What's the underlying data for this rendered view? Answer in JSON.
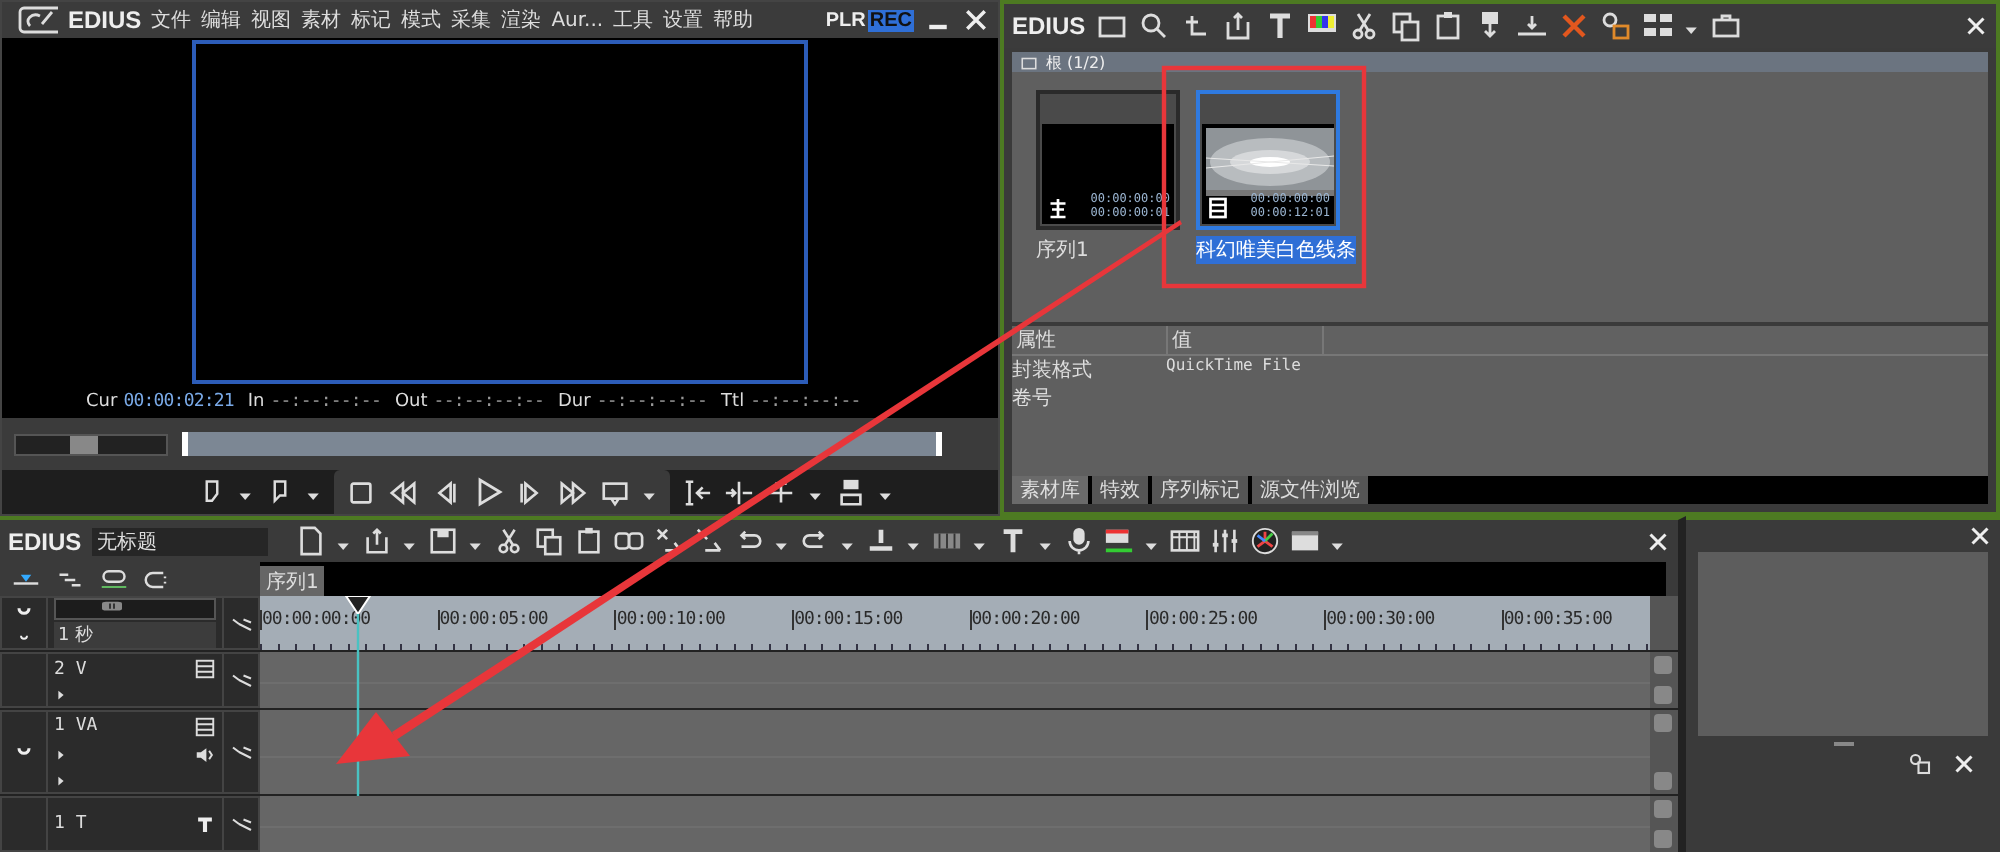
{
  "player": {
    "app_name": "EDIUS",
    "menu": [
      "文件",
      "编辑",
      "视图",
      "素材",
      "标记",
      "模式",
      "采集",
      "渲染",
      "Aur...",
      "工具",
      "设置",
      "帮助"
    ],
    "modes": [
      {
        "label": "PLR",
        "selected": false
      },
      {
        "label": "REC",
        "selected": true
      }
    ],
    "timecodes": [
      {
        "label": "Cur",
        "value": "00:00:02:21"
      },
      {
        "label": "In",
        "value": "--:--:--:--"
      },
      {
        "label": "Out",
        "value": "--:--:--:--"
      },
      {
        "label": "Dur",
        "value": "--:--:--:--"
      },
      {
        "label": "Ttl",
        "value": "--:--:--:--"
      }
    ],
    "shuttle": {
      "level": 0.45
    }
  },
  "bin": {
    "app_name": "EDIUS",
    "folder": "根 (1/2)",
    "clips": [
      {
        "name": "序列1",
        "kind": "sequence",
        "tc_in": "00:00:00:00",
        "tc_out": "00:00:00:01",
        "selected": false
      },
      {
        "name": "科幻唯美白色线条",
        "kind": "video",
        "tc_in": "00:00:00:00",
        "tc_out": "00:00:12:01",
        "selected": true
      }
    ],
    "properties": {
      "columns": [
        "属性",
        "值"
      ],
      "rows": [
        {
          "name": "封装格式",
          "value": "QuickTime File"
        },
        {
          "name": "卷号"
        }
      ]
    },
    "tabs": [
      {
        "label": "素材库",
        "selected": true
      },
      {
        "label": "特效",
        "selected": false
      },
      {
        "label": "序列标记",
        "selected": false
      },
      {
        "label": "源文件浏览",
        "selected": false
      }
    ]
  },
  "timeline": {
    "app_name": "EDIUS",
    "project": "无标题",
    "sequence_tabs": [
      {
        "label": "序列1",
        "selected": true
      }
    ],
    "scale": "1 秒",
    "ruler": [
      "00:00:00:00",
      "00:00:05:00",
      "00:00:10:00",
      "00:00:15:00",
      "00:00:20:00",
      "00:00:25:00",
      "00:00:30:00",
      "00:00:35:00"
    ],
    "playhead": {
      "level": 0.07
    },
    "zoom": {
      "level": 0.35
    },
    "tracks": [
      {
        "name": "2 V",
        "kind": "video"
      },
      {
        "name": "1 VA",
        "kind": "video_audio"
      },
      {
        "name": "1 T",
        "kind": "title"
      }
    ]
  }
}
